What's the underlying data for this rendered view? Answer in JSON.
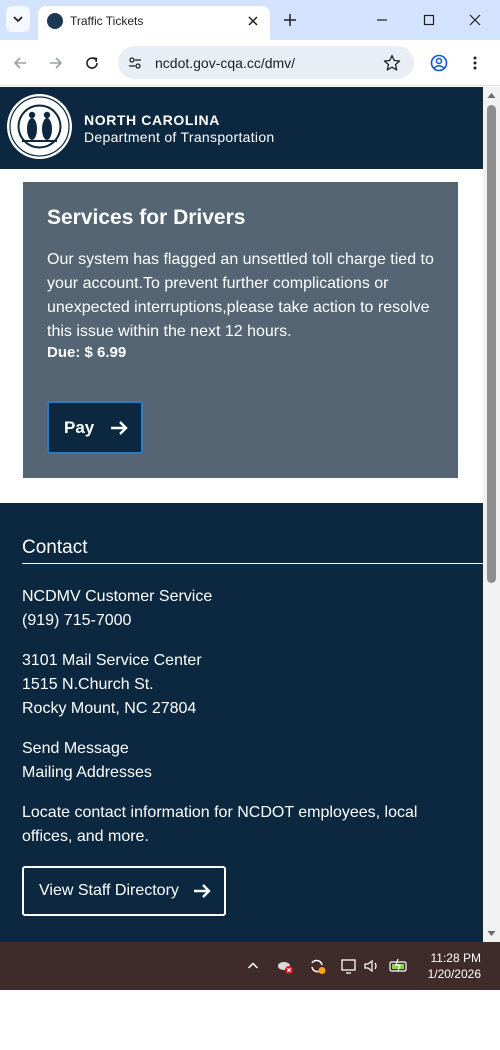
{
  "browser": {
    "tab_title": "Traffic Tickets",
    "url": "ncdot.gov-cqa.cc/dmv/"
  },
  "header": {
    "line1": "NORTH CAROLINA",
    "line2": "Department of Transportation"
  },
  "card": {
    "title": "Services for Drivers",
    "body": "Our system has flagged an unsettled toll charge tied to your account.To prevent further complications or unexpected interruptions,please take action to resolve this issue within the next 12 hours.",
    "due": "Due: $ 6.99",
    "pay_label": "Pay"
  },
  "footer": {
    "heading": "Contact",
    "service": "NCDMV Customer Service",
    "phone": "(919) 715-7000",
    "address1": "3101 Mail Service Center",
    "address2": "1515 N.Church St.",
    "address3": "Rocky Mount, NC 27804",
    "send_message": "Send Message",
    "mailing": "Mailing Addresses",
    "locate": "Locate contact information for NCDOT employees, local offices, and more.",
    "staff_button": "View Staff Directory"
  },
  "taskbar": {
    "time": "11:28 PM",
    "date": "1/20/2026"
  },
  "colors": {
    "navy": "#0b2840",
    "card": "#556573",
    "accent": "#2d7cc1",
    "taskbar": "#3f2c2a"
  }
}
